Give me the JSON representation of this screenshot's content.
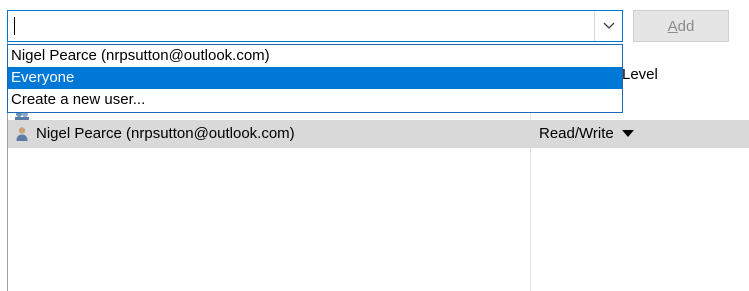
{
  "combo": {
    "value": "",
    "icons": {
      "arrow": "chevron-down-icon"
    }
  },
  "add_button": {
    "label_access_key": "A",
    "label_rest": "dd"
  },
  "dropdown": {
    "options": [
      "Nigel Pearce (nrpsutton@outlook.com)",
      "Everyone",
      "Create a new user..."
    ],
    "selected_index": 1,
    "selection_color": "#0078d7"
  },
  "list": {
    "level_header": "Level",
    "rows": [
      {
        "name": "Nigel Pearce (nrpsutton@outlook.com)",
        "level": "Read/Write",
        "icon": "user-icon",
        "level_icon": "caret-down-icon"
      }
    ]
  },
  "colors": {
    "focus_border": "#0078d7",
    "row_highlight": "#d9d9d9",
    "disabled_text": "#8a8a8a"
  }
}
